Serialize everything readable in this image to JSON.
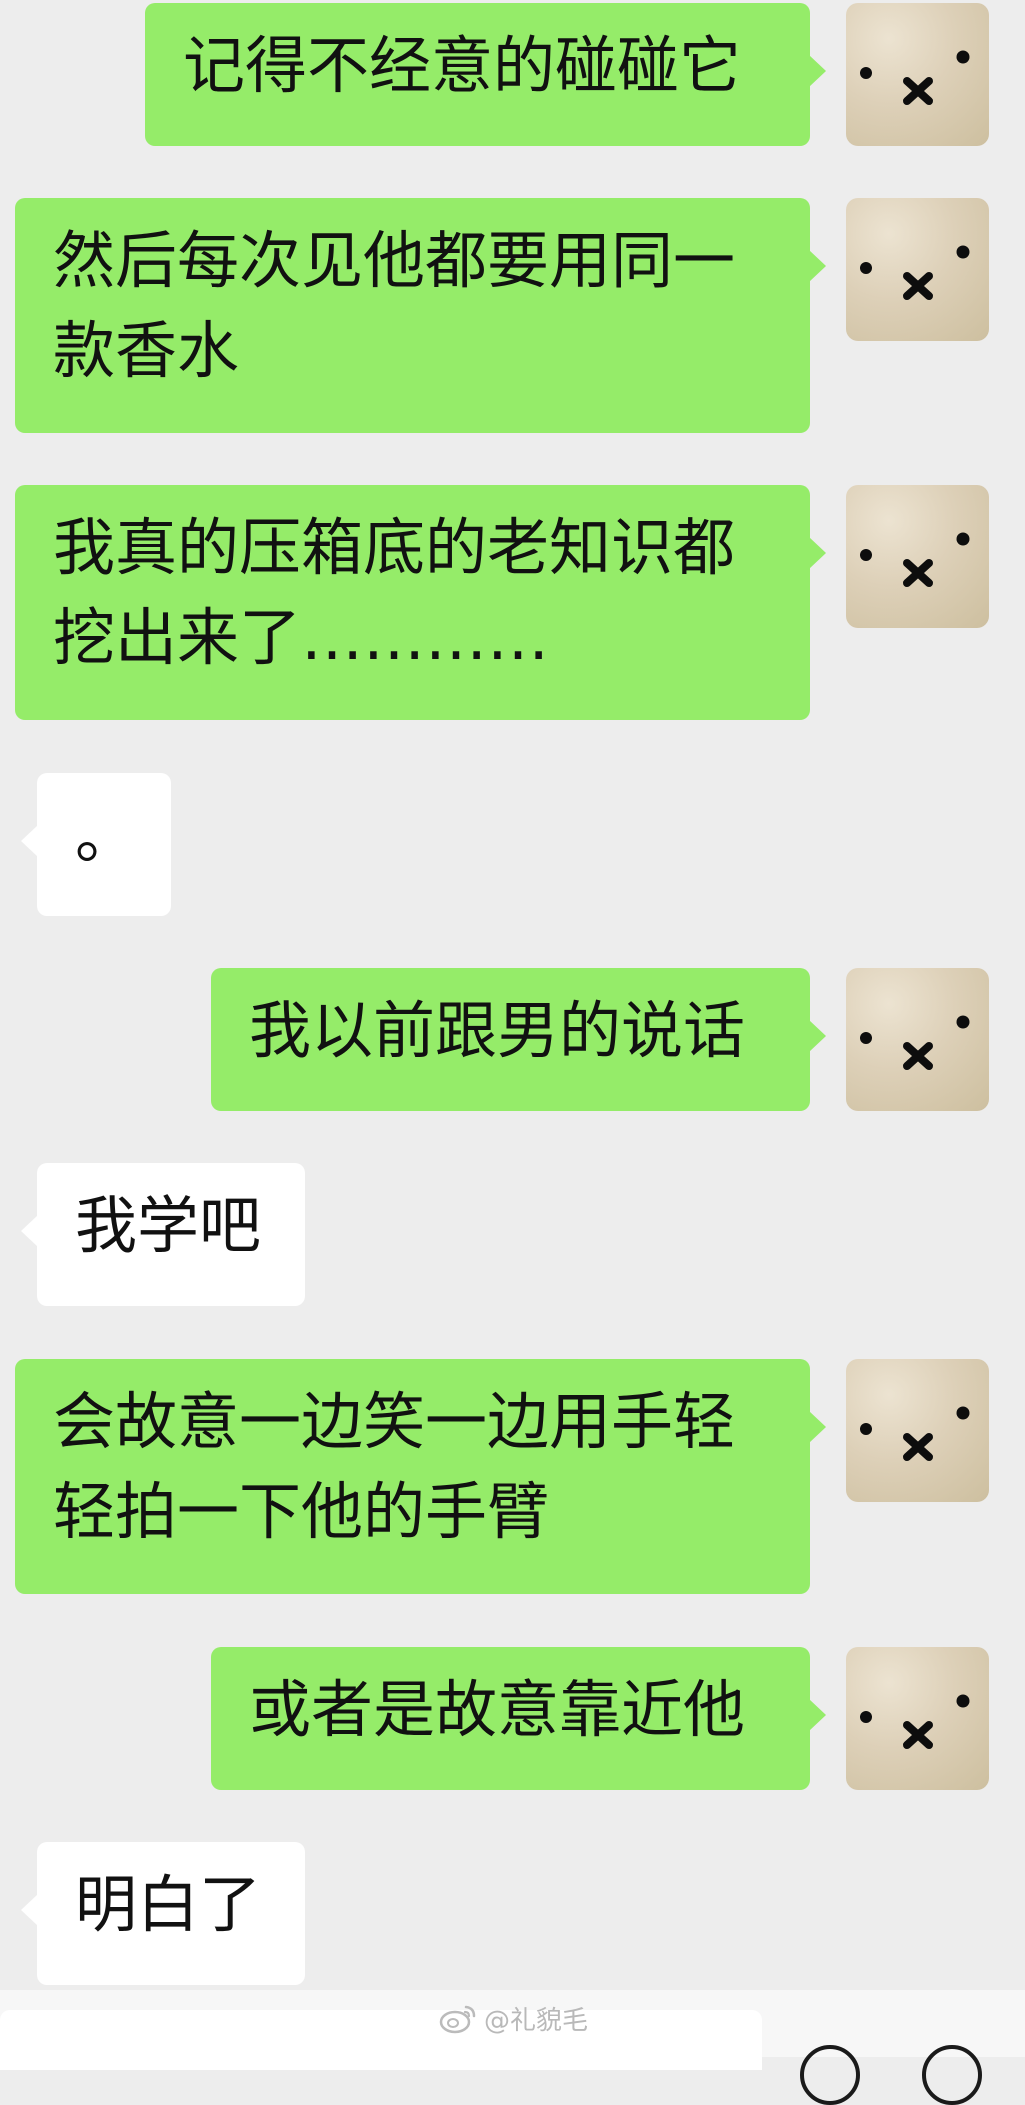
{
  "messages": [
    {
      "sender": "me",
      "text": "记得不经意的碰碰它"
    },
    {
      "sender": "me",
      "text": "然后每次见他都要用同一款香水"
    },
    {
      "sender": "me",
      "text": "我真的压箱底的老知识都挖出来了…………"
    },
    {
      "sender": "other",
      "text": "。"
    },
    {
      "sender": "me",
      "text": "我以前跟男的说话"
    },
    {
      "sender": "other",
      "text": "我学吧"
    },
    {
      "sender": "me",
      "text": "会故意一边笑一边用手轻轻拍一下他的手臂"
    },
    {
      "sender": "me",
      "text": "或者是故意靠近他"
    },
    {
      "sender": "other",
      "text": "明白了"
    }
  ],
  "watermark": {
    "text": "@礼貌毛",
    "icon": "weibo-icon"
  },
  "colors": {
    "background": "#ededed",
    "my_bubble": "#95ec69",
    "other_bubble": "#ffffff"
  },
  "avatar": {
    "icon": "doll-face-icon"
  }
}
